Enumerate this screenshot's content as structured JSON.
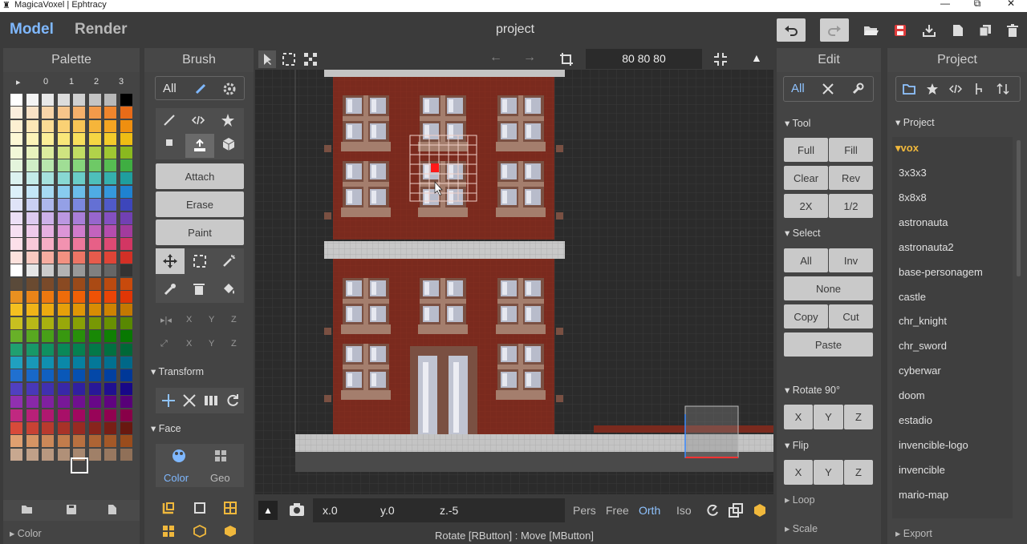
{
  "window": {
    "title": "MagicaVoxel | Ephtracy",
    "logo": "♜",
    "min": "—",
    "restore": "⧉",
    "close": "✕"
  },
  "top": {
    "model_tab": "Model",
    "render_tab": "Render",
    "project_title": "project"
  },
  "palette": {
    "title": "Palette",
    "header": [
      "▸",
      "0",
      "1",
      "2",
      "3"
    ],
    "footer_label": "Color"
  },
  "brush": {
    "title": "Brush",
    "all": "All",
    "modes": [
      "Attach",
      "Erase",
      "Paint"
    ],
    "axis1": [
      "X",
      "Y",
      "Z"
    ],
    "axis2": [
      "X",
      "Y",
      "Z"
    ],
    "transform": "Transform",
    "face": "Face",
    "face_tabs": [
      "Color",
      "Geo"
    ]
  },
  "viewport": {
    "dims": "80  80  80",
    "coords": {
      "x": "x.0",
      "y": "y.0",
      "z": "z.-5"
    },
    "cams": [
      "Pers",
      "Free",
      "Orth",
      "Iso"
    ],
    "active_cam": "Orth",
    "status": "Rotate [RButton] : Move [MButton]"
  },
  "edit": {
    "title": "Edit",
    "all": "All",
    "tool": "Tool",
    "tool_btns": [
      "Full",
      "Fill",
      "Clear",
      "Rev",
      "2X",
      "1/2"
    ],
    "select": "Select",
    "select_btns": [
      "All",
      "Inv",
      "None",
      "Copy",
      "Cut",
      "Paste"
    ],
    "rotate": "Rotate 90°",
    "rot_btns": [
      "X",
      "Y",
      "Z"
    ],
    "flip": "Flip",
    "flip_btns": [
      "X",
      "Y",
      "Z"
    ],
    "loop": "Loop",
    "scale": "Scale"
  },
  "project": {
    "title": "Project",
    "section": "Project",
    "folder": "vox",
    "items": [
      "3x3x3",
      "8x8x8",
      "astronauta",
      "astronauta2",
      "base-personagem",
      "castle",
      "chr_knight",
      "chr_sword",
      "cyberwar",
      "doom",
      "estadio",
      "invencible-logo",
      "invencible",
      "mario-map"
    ],
    "export": "Export"
  },
  "colors": {
    "accent": "#7fb8ff",
    "save": "#e03b3b",
    "brick": "#7a2a1e"
  }
}
